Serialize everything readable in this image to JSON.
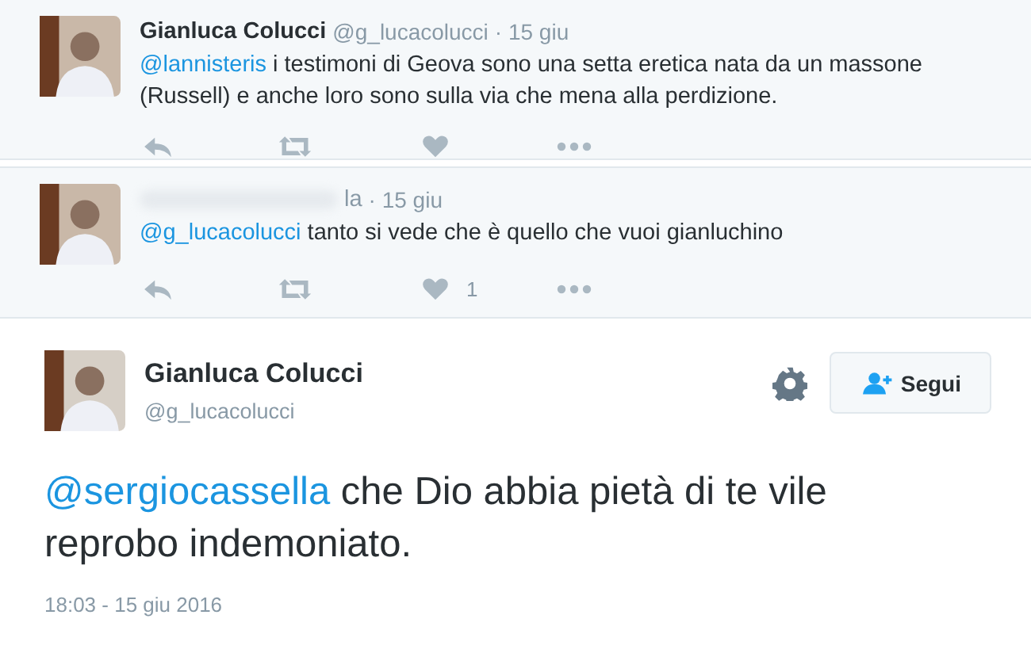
{
  "replies": [
    {
      "name": "Gianluca Colucci",
      "name_blurred": false,
      "handle": "@g_lucacolucci",
      "time": "· 15 giu",
      "mention": "@lannisteris",
      "text": "i testimoni di Geova sono una setta eretica nata da un massone (Russell) e anche loro sono sulla via che mena alla perdizione."
    },
    {
      "name": "la",
      "name_blurred": true,
      "time": "· 15 giu",
      "mention": "@g_lucacolucci",
      "text": "tanto si vede che è quello che vuoi gianluchino",
      "likes": "1"
    }
  ],
  "tweet": {
    "name": "Gianluca Colucci",
    "handle": "@g_lucacolucci",
    "follow_label": "Segui",
    "mention": "@sergiocassella",
    "text": "che Dio abbia pietà di te vile reprobo indemoniato.",
    "timestamp": "18:03 - 15 giu 2016"
  }
}
